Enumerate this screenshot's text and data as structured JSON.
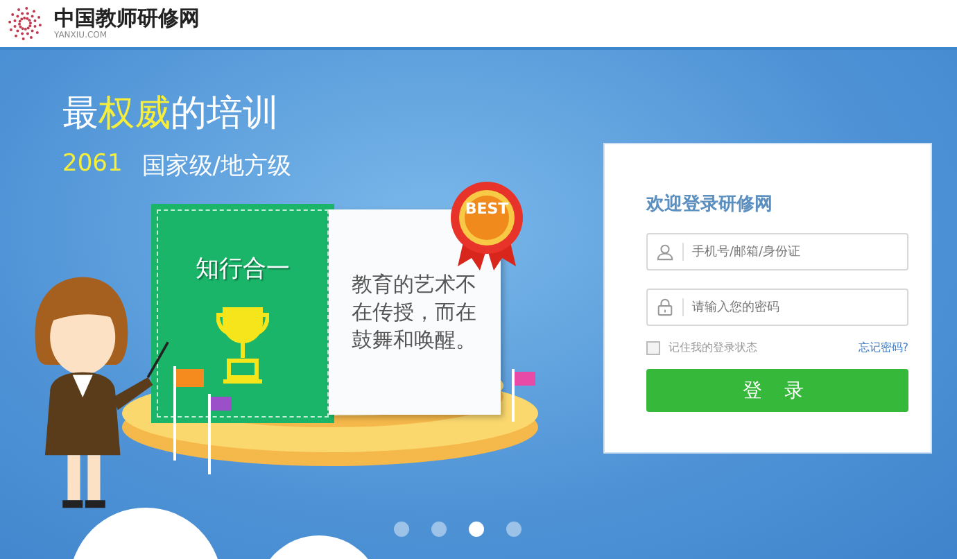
{
  "header": {
    "site_name": "中国教师研修网",
    "site_domain": "YANXIU.COM"
  },
  "banner": {
    "headline": "最**权威**的培训",
    "count": "2061",
    "levels": "国家级/地方级",
    "card_title": "知行合一",
    "quote": "教育的艺术不在传授，而在鼓舞和唤醒。",
    "badge": "BEST"
  },
  "carousel": {
    "dots": [
      {
        "selected": false
      },
      {
        "selected": false
      },
      {
        "selected": true
      },
      {
        "selected": false
      }
    ]
  },
  "login": {
    "title": "欢迎登录研修网",
    "fields": [
      {
        "kind": "user",
        "placeholder": "手机号/邮箱/身份证"
      },
      {
        "kind": "password",
        "placeholder": "请输入您的密码"
      }
    ],
    "remember": {
      "label": "记住我的登录状态",
      "checked": false
    },
    "forgot_link": "忘记密码?",
    "submit": "登 录"
  }
}
